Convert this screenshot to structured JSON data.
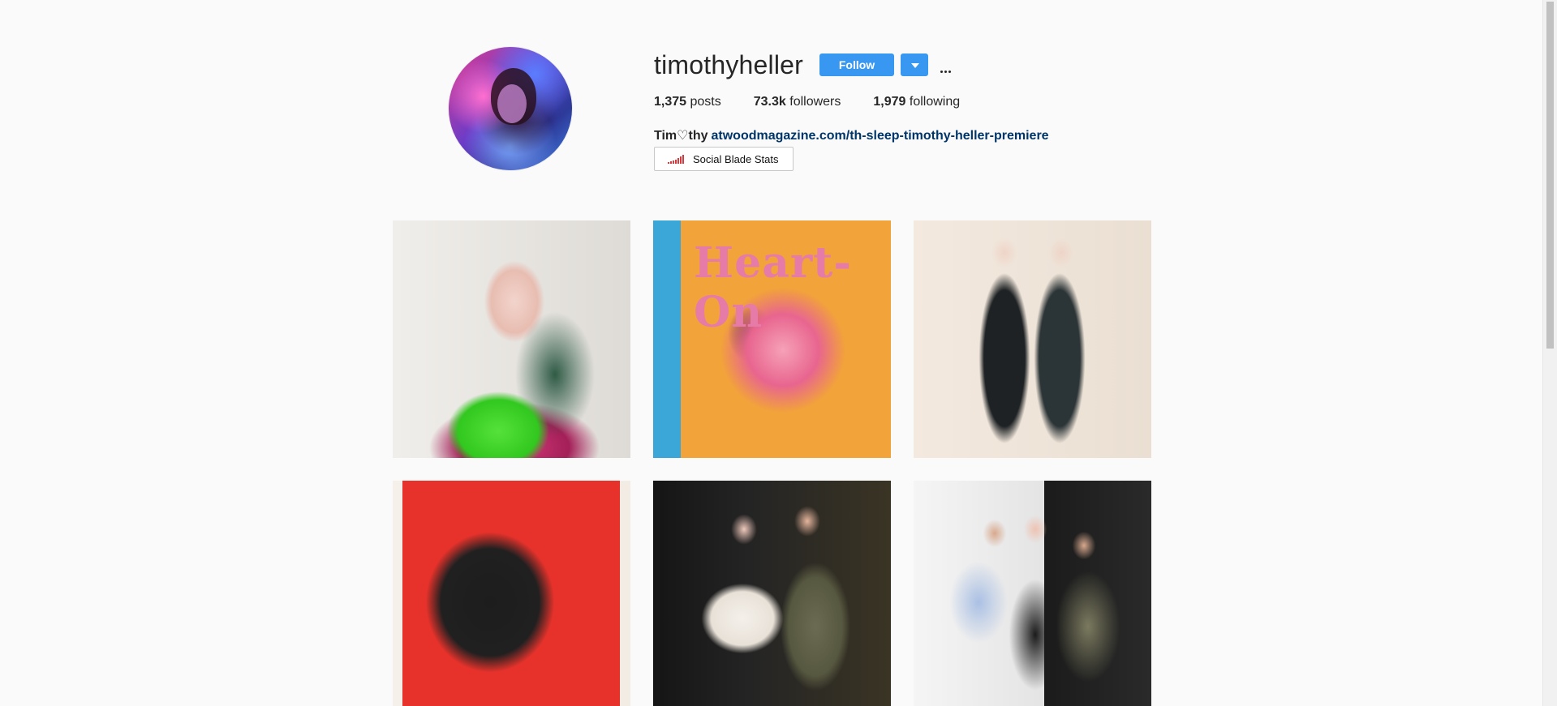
{
  "profile": {
    "username": "timothyheller",
    "follow_label": "Follow",
    "stats": {
      "posts_count": "1,375",
      "posts_label": "posts",
      "followers_count": "73.3k",
      "followers_label": "followers",
      "following_count": "1,979",
      "following_label": "following"
    },
    "bio": {
      "name": "Tim♡thy",
      "link_text": "atwoodmagazine.com/th-sleep-timothy-heller-premiere"
    },
    "social_blade_label": "Social Blade Stats"
  },
  "icons": {
    "dropdown": "chevron-down-icon",
    "more": "more-options-icon",
    "social_blade": "signal-bars-icon"
  },
  "colors": {
    "accent": "#3897f0",
    "link": "#003569",
    "social_blade_red": "#d6383b",
    "background": "#fafafa"
  },
  "posts": [
    {
      "heart_text": ""
    },
    {
      "heart_text": "Heart-On"
    },
    {
      "heart_text": ""
    },
    {
      "heart_text": ""
    },
    {
      "heart_text": ""
    },
    {
      "heart_text": ""
    }
  ]
}
